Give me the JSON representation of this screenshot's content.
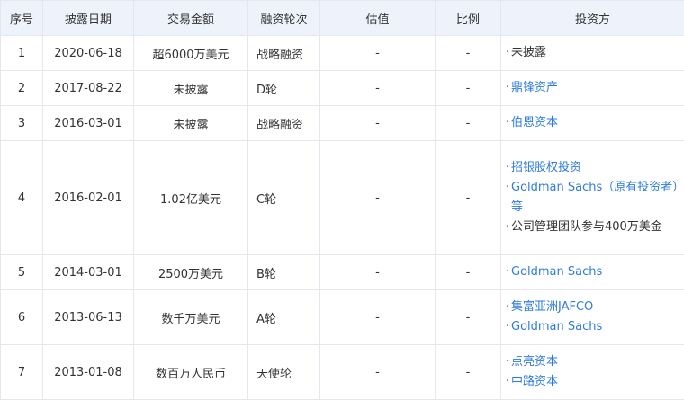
{
  "headers": {
    "seq": "序号",
    "date": "披露日期",
    "amount": "交易金额",
    "round": "融资轮次",
    "valuation": "估值",
    "ratio": "比例",
    "investors": "投资方"
  },
  "rows": [
    {
      "seq": "1",
      "date": "2020-06-18",
      "amount": "超6000万美元",
      "round": "战略融资",
      "valuation": "-",
      "ratio": "-",
      "investors": [
        {
          "text": "未披露",
          "link": false
        }
      ]
    },
    {
      "seq": "2",
      "date": "2017-08-22",
      "amount": "未披露",
      "round": "D轮",
      "valuation": "-",
      "ratio": "-",
      "investors": [
        {
          "text": "鼎锋资产",
          "link": true
        }
      ]
    },
    {
      "seq": "3",
      "date": "2016-03-01",
      "amount": "未披露",
      "round": "战略融资",
      "valuation": "-",
      "ratio": "-",
      "investors": [
        {
          "text": "伯恩资本",
          "link": true
        }
      ]
    },
    {
      "seq": "4",
      "date": "2016-02-01",
      "amount": "1.02亿美元",
      "round": "C轮",
      "valuation": "-",
      "ratio": "-",
      "investors": [
        {
          "text": "招银股权投资",
          "link": true
        },
        {
          "text": "Goldman Sachs（原有投资者）等",
          "link": true
        },
        {
          "text": "公司管理团队参与400万美金",
          "link": false
        }
      ]
    },
    {
      "seq": "5",
      "date": "2014-03-01",
      "amount": "2500万美元",
      "round": "B轮",
      "valuation": "-",
      "ratio": "-",
      "investors": [
        {
          "text": "Goldman Sachs",
          "link": true
        }
      ]
    },
    {
      "seq": "6",
      "date": "2013-06-13",
      "amount": "数千万美元",
      "round": "A轮",
      "valuation": "-",
      "ratio": "-",
      "investors": [
        {
          "text": "集富亚洲JAFCO",
          "link": true
        },
        {
          "text": "Goldman Sachs",
          "link": true
        }
      ]
    },
    {
      "seq": "7",
      "date": "2013-01-08",
      "amount": "数百万人民币",
      "round": "天使轮",
      "valuation": "-",
      "ratio": "-",
      "investors": [
        {
          "text": "点亮资本",
          "link": true
        },
        {
          "text": "中路资本",
          "link": true
        }
      ]
    }
  ],
  "colors": {
    "link": "#2d7be0",
    "header_bg": "#eef3fb",
    "border": "#e4e7ef",
    "text": "#333333"
  },
  "bullet_char": "·"
}
